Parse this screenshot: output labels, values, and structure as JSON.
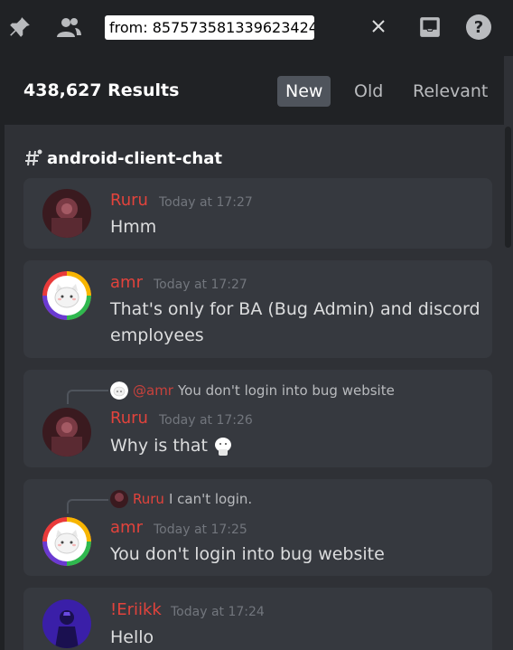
{
  "toolbar": {
    "search_value": "from: 857573581339623424",
    "icons": [
      "pin-icon",
      "members-icon",
      "close-icon",
      "inbox-icon",
      "help-icon"
    ]
  },
  "results": {
    "count": "438,627 Results",
    "sort_new": "New",
    "sort_old": "Old",
    "sort_relevant": "Relevant",
    "active_sort": "New"
  },
  "channel": {
    "name": "android-client-chat"
  },
  "messages": [
    {
      "author": "Ruru",
      "timestamp": "Today at 17:27",
      "content": "Hmm"
    },
    {
      "author": "amr",
      "timestamp": "Today at 17:27",
      "content": "That's only for BA (Bug Admin) and discord employees"
    },
    {
      "reply_mention": "@amr",
      "reply_text": "You don't login into bug website",
      "author": "Ruru",
      "timestamp": "Today at 17:26",
      "content": "Why is that"
    },
    {
      "reply_author": "Ruru",
      "reply_text": "I can't login.",
      "author": "amr",
      "timestamp": "Today at 17:25",
      "content": "You don't login into bug website"
    },
    {
      "author": "!Eriikk",
      "timestamp": "Today at 17:24",
      "content": "Hello"
    }
  ],
  "colors": {
    "background": "#2f3136",
    "toolbar": "#202225",
    "message_card": "#36393f",
    "author_red": "#e2433c",
    "timestamp": "#72767d",
    "active_sort_bg": "#4f545c"
  }
}
